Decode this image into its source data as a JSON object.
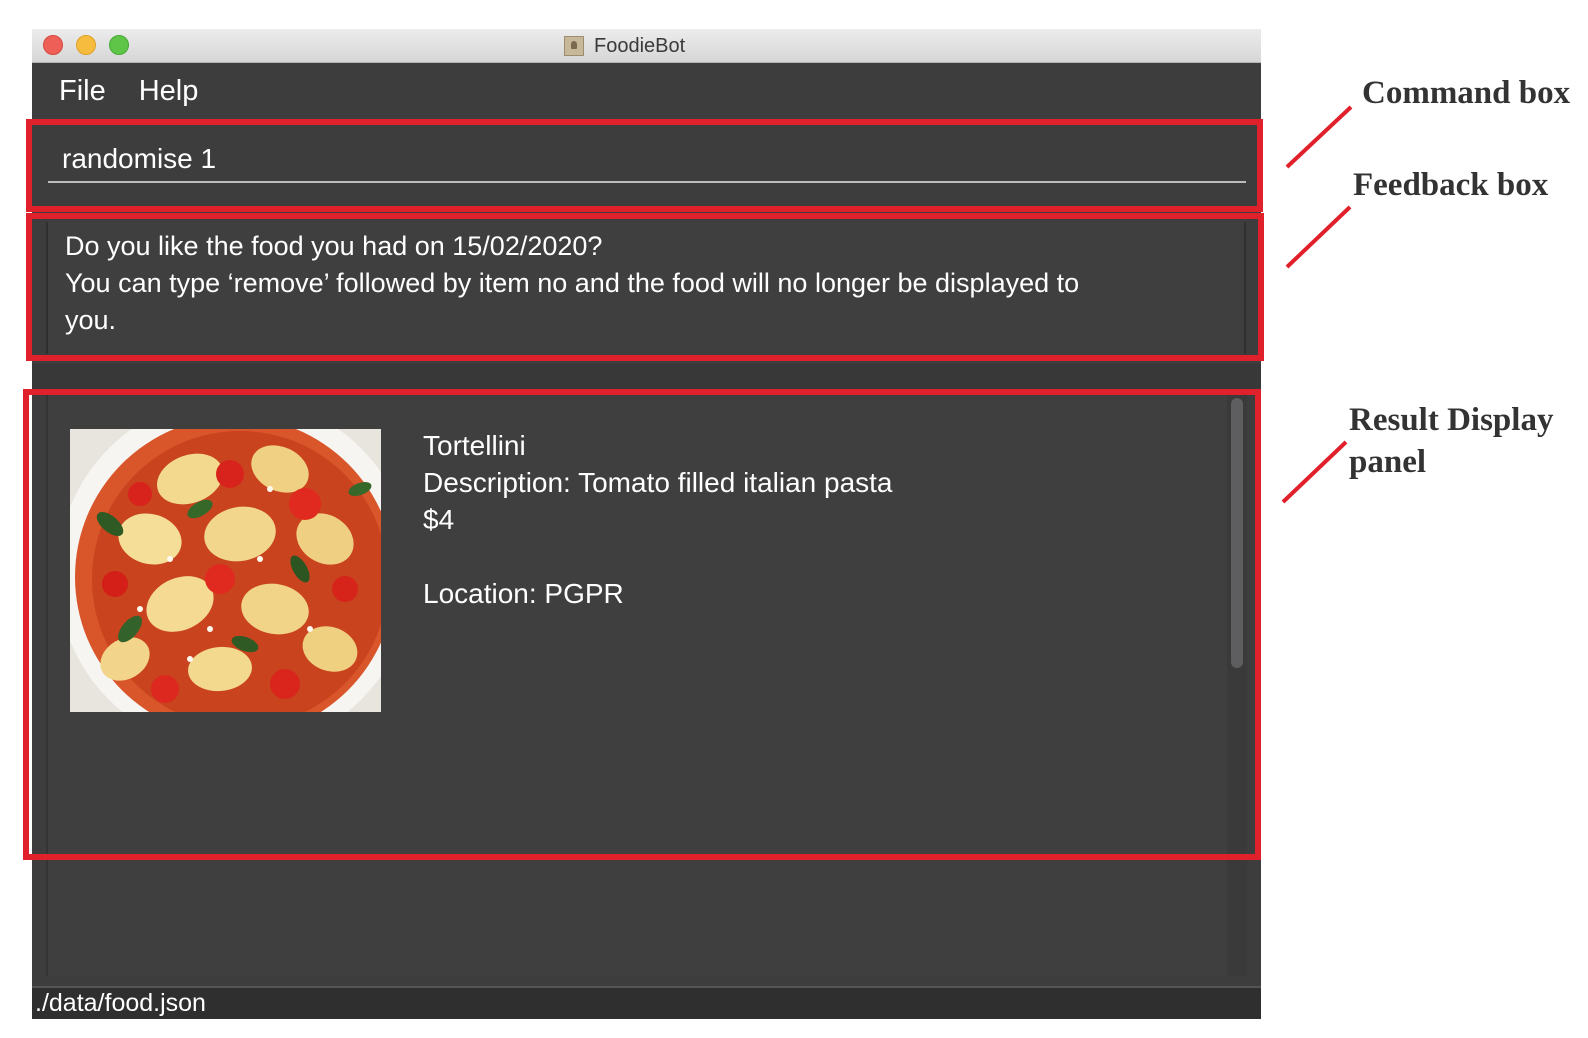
{
  "window": {
    "title": "FoodieBot"
  },
  "menu": {
    "items": [
      "File",
      "Help"
    ]
  },
  "command_box": {
    "value": "randomise 1"
  },
  "feedback": {
    "line1": "Do you like the food you had on 15/02/2020?",
    "line2": "You can type ‘remove’  followed by item no and the food will no longer be displayed to",
    "line3": "you."
  },
  "result": {
    "food": {
      "name": "Tortellini",
      "description": "Description: Tomato filled italian pasta",
      "price": "$4",
      "location": "Location: PGPR",
      "image_icon": "tortellini-photo"
    }
  },
  "status_bar": {
    "path": "./data/food.json"
  },
  "annotations": {
    "command_box": "Command box",
    "feedback_box": "Feedback box",
    "result_panel_line1": "Result Display",
    "result_panel_line2": "panel"
  },
  "colors": {
    "annotation_red": "#e0202a",
    "window_bg": "#3d3d3e"
  }
}
